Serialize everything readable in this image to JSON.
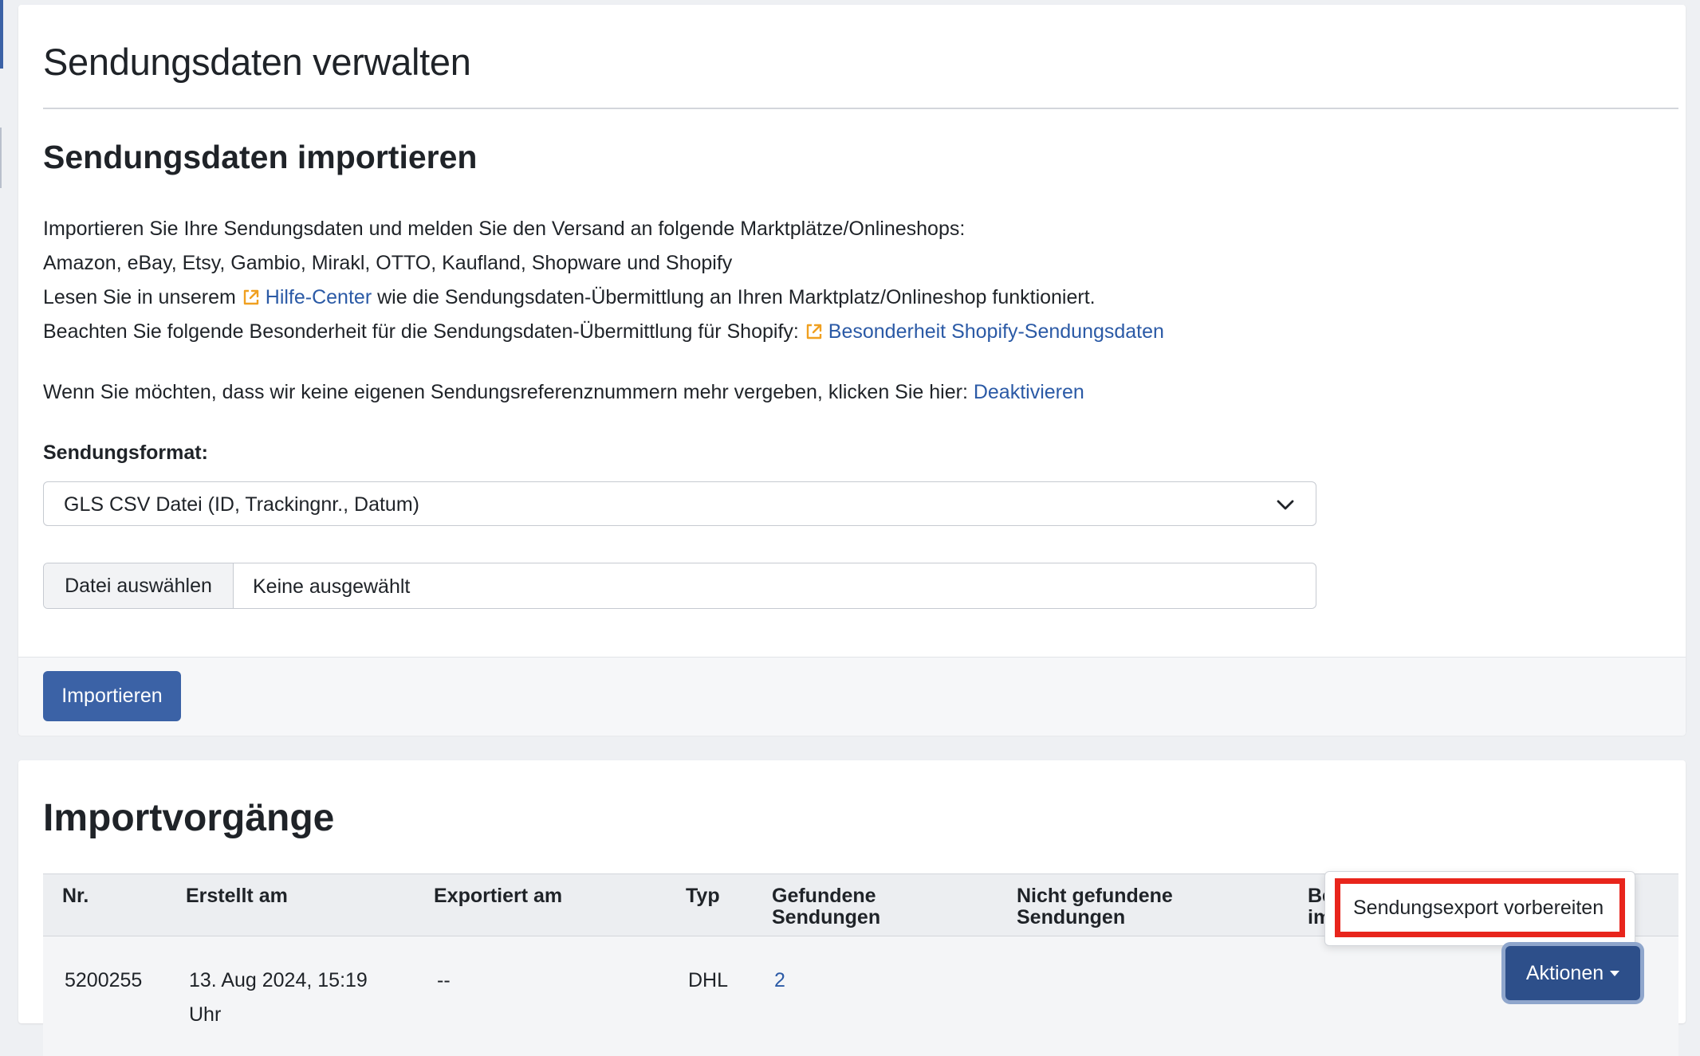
{
  "page": {
    "title": "Sendungsdaten verwalten"
  },
  "import_section": {
    "title": "Sendungsdaten importieren",
    "intro_line1": "Importieren Sie Ihre Sendungsdaten und melden Sie den Versand an folgende Marktplätze/Onlineshops:",
    "intro_line2": "Amazon, eBay, Etsy, Gambio, Mirakl, OTTO, Kaufland, Shopware und Shopify",
    "help_prefix": "Lesen Sie in unserem",
    "help_link": "Hilfe-Center",
    "help_suffix": "wie die Sendungsdaten-Übermittlung an Ihren Marktplatz/Onlineshop funktioniert.",
    "shopify_prefix": "Beachten Sie folgende Besonderheit für die Sendungsdaten-Übermittlung für Shopify:",
    "shopify_link": "Besonderheit Shopify-Sendungsdaten",
    "deactivate_prefix": "Wenn Sie möchten, dass wir keine eigenen Sendungsreferenznummern mehr vergeben, klicken Sie hier:",
    "deactivate_link": "Deaktivieren",
    "format_label": "Sendungsformat:",
    "format_selected": "GLS CSV Datei (ID, Trackingnr., Datum)",
    "file_button": "Datei auswählen",
    "file_status": "Keine ausgewählt",
    "import_button": "Importieren"
  },
  "history": {
    "title": "Importvorgänge",
    "columns": [
      "Nr.",
      "Erstellt am",
      "Exportiert am",
      "Typ",
      "Gefundene Sendungen",
      "Nicht gefundene Sendungen",
      "Bei im"
    ],
    "rows": [
      {
        "nr": "5200255",
        "created": "13. Aug 2024, 15:19 Uhr",
        "exported": "--",
        "type": "DHL",
        "found": "2",
        "not_found": "",
        "actions_label": "Aktionen"
      }
    ]
  },
  "actions_menu": {
    "items": [
      "Sendungsexport vorbereiten"
    ]
  },
  "colors": {
    "primary": "#3b62a6",
    "link": "#2b5aa6",
    "external_icon": "#f0a020",
    "highlight": "#e8251c"
  },
  "icons": {
    "external_link": "external-link-icon",
    "select_chevron": "chevron-down-icon",
    "dropdown_caret": "caret-down-icon"
  }
}
